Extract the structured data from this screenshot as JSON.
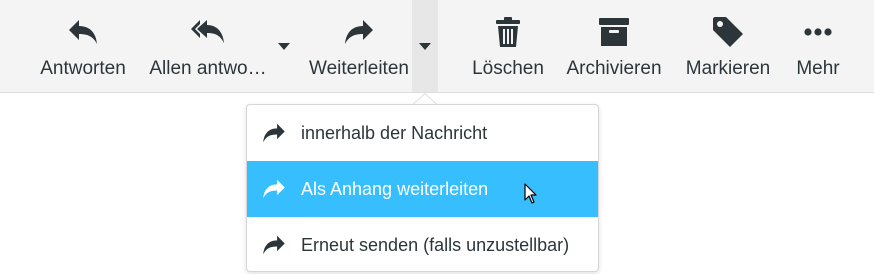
{
  "toolbar": {
    "reply": {
      "label": "Antworten",
      "icon": "reply-icon"
    },
    "reply_all": {
      "label": "Allen antwo…",
      "icon": "reply-all-icon"
    },
    "forward": {
      "label": "Weiterleiten",
      "icon": "forward-icon"
    },
    "delete": {
      "label": "Löschen",
      "icon": "trash-icon"
    },
    "archive": {
      "label": "Archivieren",
      "icon": "archive-icon"
    },
    "mark": {
      "label": "Markieren",
      "icon": "tag-icon"
    },
    "more": {
      "label": "Mehr",
      "icon": "more-dots-icon"
    }
  },
  "forward_menu": {
    "items": [
      {
        "label": "innerhalb der Nachricht",
        "icon": "forward-icon"
      },
      {
        "label": "Als Anhang weiterleiten",
        "icon": "forward-icon"
      },
      {
        "label": "Erneut senden (falls unzustellbar)",
        "icon": "forward-icon"
      }
    ],
    "hovered_item": "Als Anhang weiterleiten"
  },
  "colors": {
    "toolbar_bg": "#f4f4f4",
    "text": "#2c363a",
    "hover": "#37beff"
  }
}
